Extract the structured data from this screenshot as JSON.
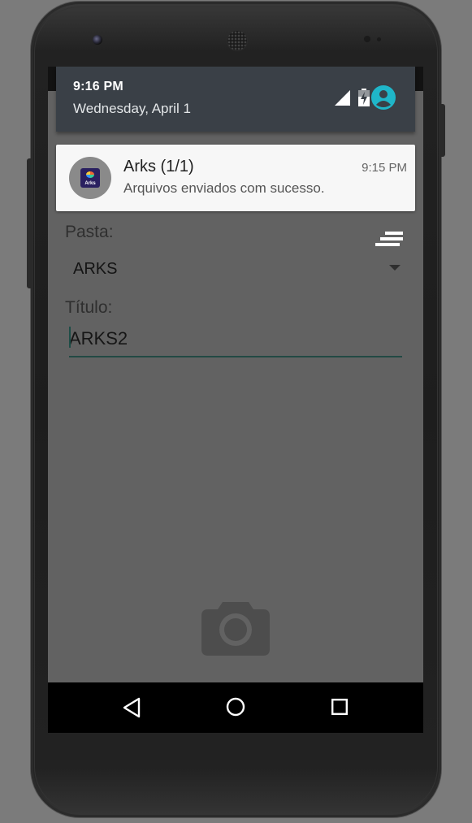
{
  "status_bar": {
    "time": "9:16 PM",
    "date": "Wednesday, April 1"
  },
  "notification": {
    "app_logo_text": "Arks",
    "title": "Arks (1/1)",
    "time": "9:15 PM",
    "text": "Arquivos enviados com sucesso."
  },
  "form": {
    "folder_label": "Pasta:",
    "folder_value": "ARKS",
    "title_label": "Título:",
    "title_value": "ARKS2"
  },
  "icons": {
    "signal": "signal-icon",
    "battery": "battery-charging-icon",
    "user": "account-circle-icon",
    "menu": "sort-menu-icon",
    "camera": "camera-icon",
    "back": "back-icon",
    "home": "home-icon",
    "recents": "recents-icon"
  },
  "colors": {
    "accent": "#1fb6c9",
    "shade_bg": "#3a4047",
    "app_bg": "#626262",
    "input_underline": "#234a44"
  }
}
